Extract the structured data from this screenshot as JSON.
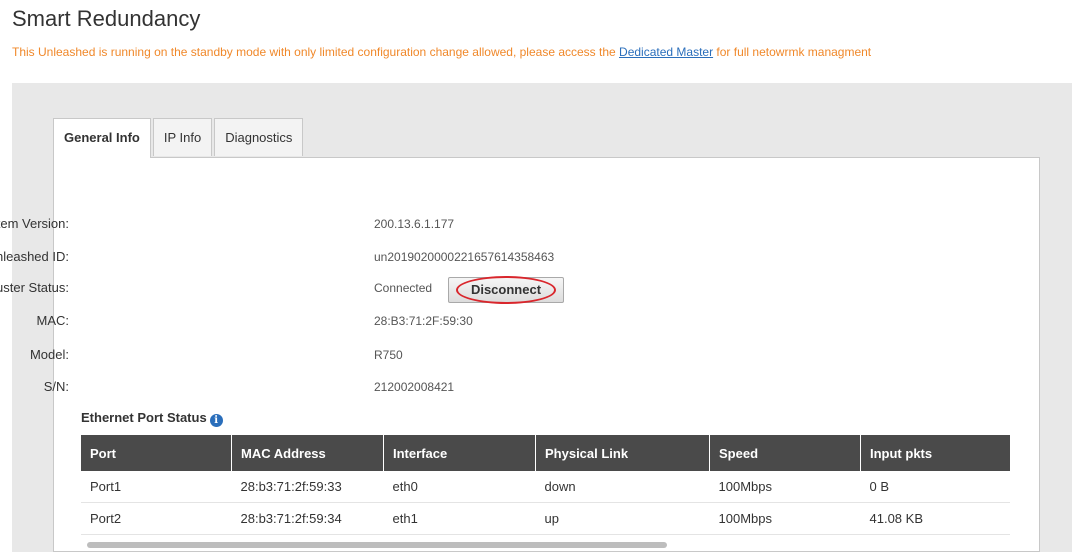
{
  "page": {
    "title": "Smart Redundancy",
    "notice_prefix": "This Unleashed is running on the standby mode with only limited configuration change allowed, please access the ",
    "notice_link": "Dedicated Master",
    "notice_suffix": " for full netowrmk managment"
  },
  "tabs": [
    {
      "label": "General Info",
      "active": true
    },
    {
      "label": "IP Info",
      "active": false
    },
    {
      "label": "Diagnostics",
      "active": false
    }
  ],
  "general": {
    "system_version_label": "System Version:",
    "system_version": "200.13.6.1.177",
    "unleashed_id_label": "Unleashed ID:",
    "unleashed_id": "un20190200002216576143584​63",
    "cluster_status_label": "Cluster Status:",
    "cluster_status": "Connected",
    "disconnect_label": "Disconnect",
    "mac_label": "MAC:",
    "mac": "28:B3:71:2F:59:30",
    "model_label": "Model:",
    "model": "R750",
    "sn_label": "S/N:",
    "sn": "212002008421"
  },
  "ethernet": {
    "title": "Ethernet Port Status",
    "info_icon": "i",
    "columns": [
      "Port",
      "MAC Address",
      "Interface",
      "Physical Link",
      "Speed",
      "Input pkts"
    ],
    "rows": [
      [
        "Port1",
        "28:b3:71:2f:59:33",
        "eth0",
        "down",
        "100Mbps",
        "0 B"
      ],
      [
        "Port2",
        "28:b3:71:2f:59:34",
        "eth1",
        "up",
        "100Mbps",
        "41.08 KB"
      ]
    ]
  },
  "colors": {
    "notice": "#f0882a",
    "link": "#2a6ebb",
    "table_header": "#4a4a4a",
    "highlight_ellipse": "#d9262c"
  }
}
